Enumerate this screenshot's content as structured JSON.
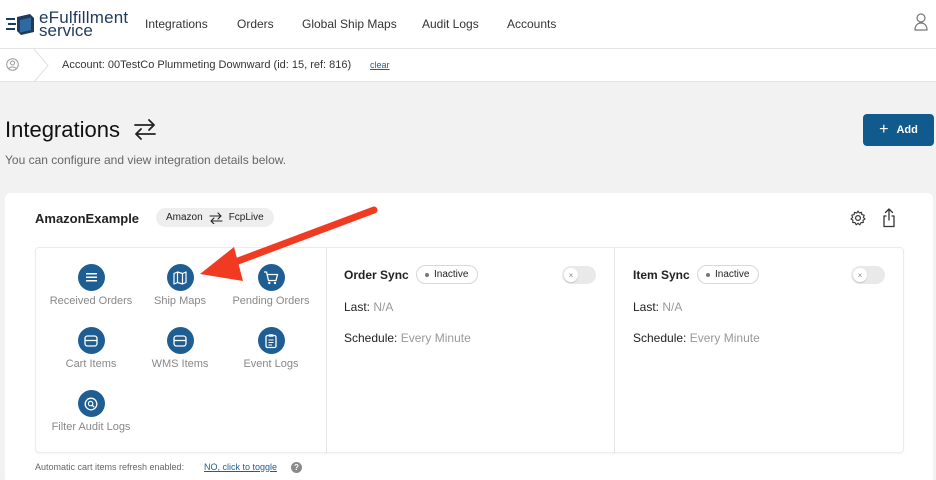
{
  "logo": {
    "line1": "eFulfillment",
    "line2": "service"
  },
  "nav": {
    "items": [
      "Integrations",
      "Orders",
      "Global Ship Maps",
      "Audit Logs",
      "Accounts"
    ]
  },
  "account": {
    "text": "Account: 00TestCo Plummeting Downward (id: 15, ref: 816)",
    "clear": "clear"
  },
  "page": {
    "title": "Integrations",
    "subtitle": "You can configure and view integration details below.",
    "add_label": "Add"
  },
  "integration": {
    "name": "AmazonExample",
    "source": "Amazon",
    "target": "FcpLive",
    "tiles": [
      {
        "label": "Received Orders",
        "icon": "list-icon"
      },
      {
        "label": "Ship Maps",
        "icon": "map-icon"
      },
      {
        "label": "Pending Orders",
        "icon": "cart-icon"
      },
      {
        "label": "Cart Items",
        "icon": "box-icon"
      },
      {
        "label": "WMS Items",
        "icon": "box-icon"
      },
      {
        "label": "Event Logs",
        "icon": "clipboard-icon"
      },
      {
        "label": "Filter Audit Logs",
        "icon": "search-icon"
      }
    ],
    "order_sync": {
      "title": "Order Sync",
      "status": "Inactive",
      "last_label": "Last:",
      "last_value": "N/A",
      "schedule_label": "Schedule:",
      "schedule_value": "Every Minute"
    },
    "item_sync": {
      "title": "Item Sync",
      "status": "Inactive",
      "last_label": "Last:",
      "last_value": "N/A",
      "schedule_label": "Schedule:",
      "schedule_value": "Every Minute"
    }
  },
  "footer": {
    "note": "Automatic cart items refresh enabled:",
    "link": "NO, click to toggle",
    "help": "?"
  },
  "toggle_x": "×",
  "colors": {
    "primary": "#115a8e",
    "icon_bg": "#1f5e93",
    "annotation_arrow": "#f03a22"
  }
}
